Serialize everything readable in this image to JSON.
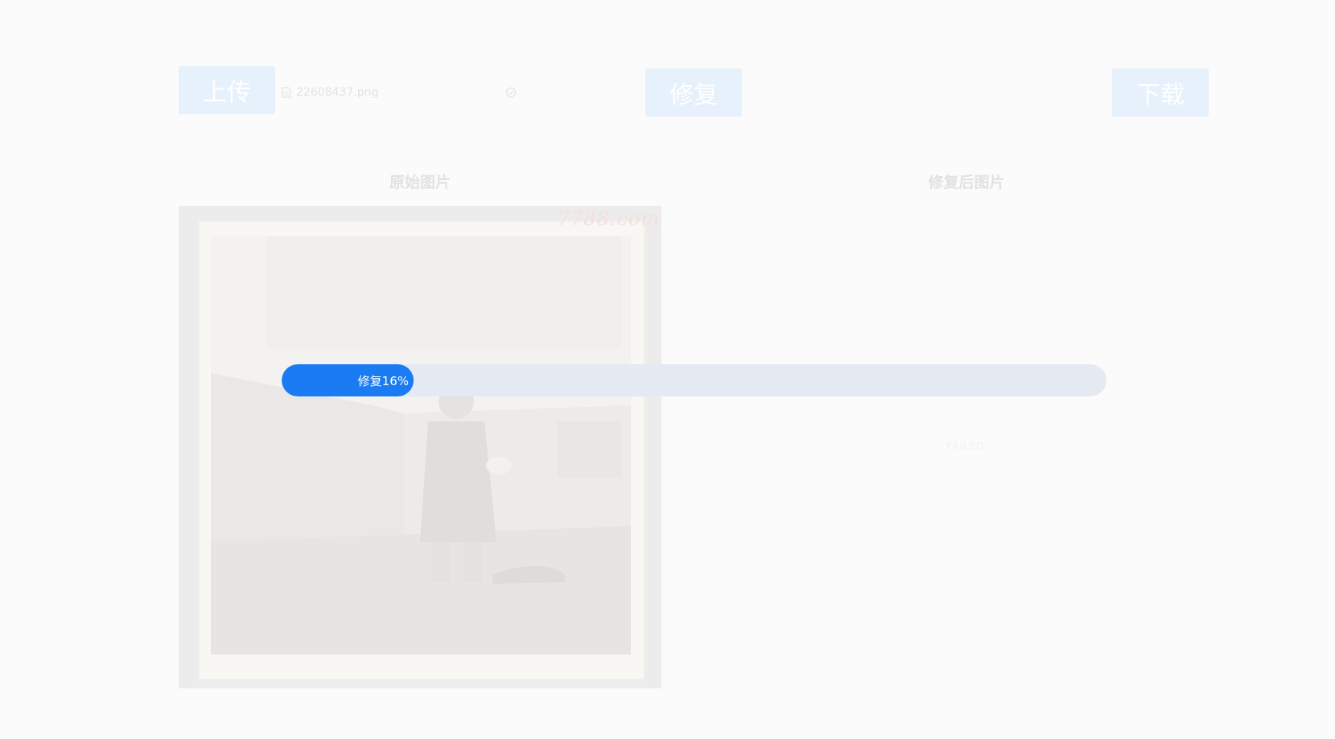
{
  "toolbar": {
    "upload_label": "上传",
    "repair_label": "修复",
    "download_label": "下载"
  },
  "file": {
    "name": "22608437.png",
    "icon": "document-icon",
    "status_icon": "check-circle-icon"
  },
  "columns": {
    "original_title": "原始图片",
    "repaired_title": "修复后图片"
  },
  "original_image": {
    "watermark": "7788.com",
    "description_icon": "old-photo"
  },
  "repaired_image": {
    "status": "FAILED"
  },
  "progress": {
    "label": "修复16%",
    "percent": 16
  },
  "colors": {
    "accent": "#1a7bf3",
    "track": "#e5e9f2",
    "button_bg": "#e7f1fb"
  }
}
